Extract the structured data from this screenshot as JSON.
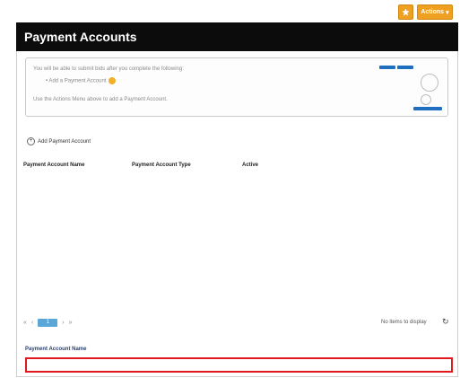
{
  "toolbar": {
    "star_icon": "star-icon",
    "actions_label": "Actions",
    "actions_caret": "▾",
    "accent_color": "#f0a020"
  },
  "panel": {
    "title": "Payment Accounts",
    "header_color": "#0c0c0c"
  },
  "info": {
    "line1": "You will be able to submit bids after you complete the following:",
    "line2": "• Add a Payment Account",
    "line3": "Use the Actions Menu above to add a Payment Account."
  },
  "add_account": {
    "label": "Add Payment Account"
  },
  "table": {
    "columns": [
      "Payment Account Name",
      "Payment Account Type",
      "Active"
    ],
    "rows": []
  },
  "pager": {
    "first": "«",
    "prev": "‹",
    "current": "1",
    "next": "›",
    "last": "»",
    "status": "No items to display"
  },
  "form": {
    "name_label": "Payment Account Name",
    "name_value": "",
    "name_error_color": "#e0191f"
  }
}
